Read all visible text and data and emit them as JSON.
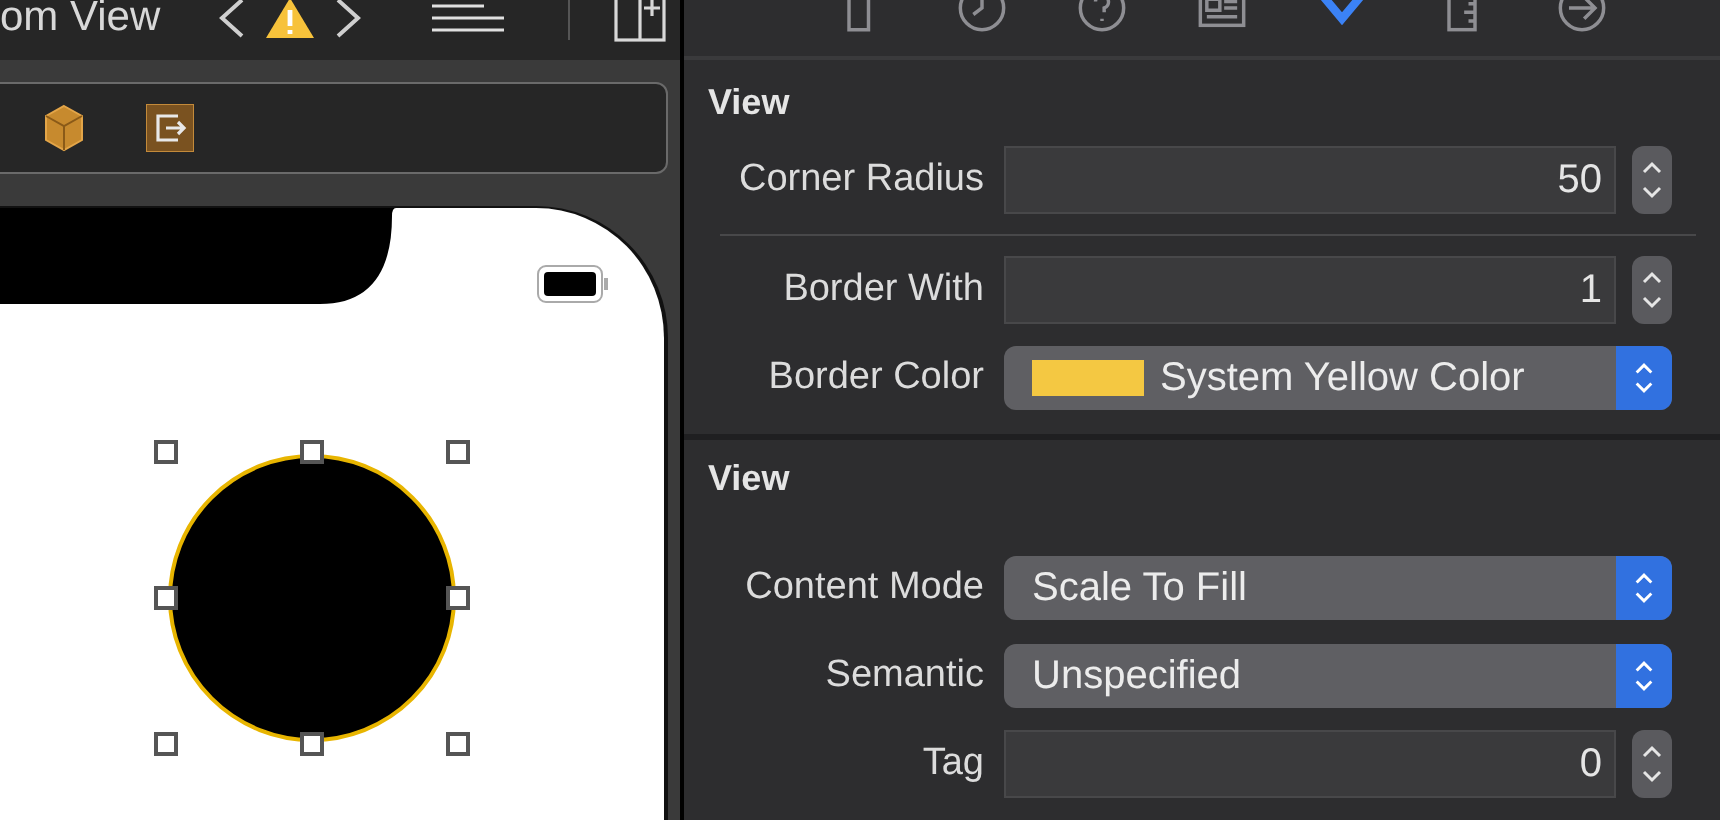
{
  "editor": {
    "title": "om View",
    "view_selected": true
  },
  "inspector_tabs": [
    {
      "selected": false
    },
    {
      "selected": false
    },
    {
      "selected": false
    },
    {
      "selected": false
    },
    {
      "selected": true
    },
    {
      "selected": false
    },
    {
      "selected": false
    }
  ],
  "sections": [
    {
      "title": "View",
      "rows": [
        {
          "kind": "stepper",
          "label": "Corner Radius",
          "value": "50",
          "separator": true
        },
        {
          "kind": "stepper",
          "label": "Border With",
          "value": "1",
          "separator": false
        },
        {
          "kind": "color",
          "label": "Border Color",
          "value": "System Yellow Color",
          "color": "#f4c842",
          "separator": false
        }
      ]
    },
    {
      "title": "View",
      "rows": [
        {
          "kind": "popup",
          "label": "Content Mode",
          "value": "Scale To Fill",
          "separator": false
        },
        {
          "kind": "popup",
          "label": "Semantic",
          "value": "Unspecified",
          "separator": false
        },
        {
          "kind": "stepper",
          "label": "Tag",
          "value": "0",
          "separator": false
        }
      ]
    }
  ]
}
